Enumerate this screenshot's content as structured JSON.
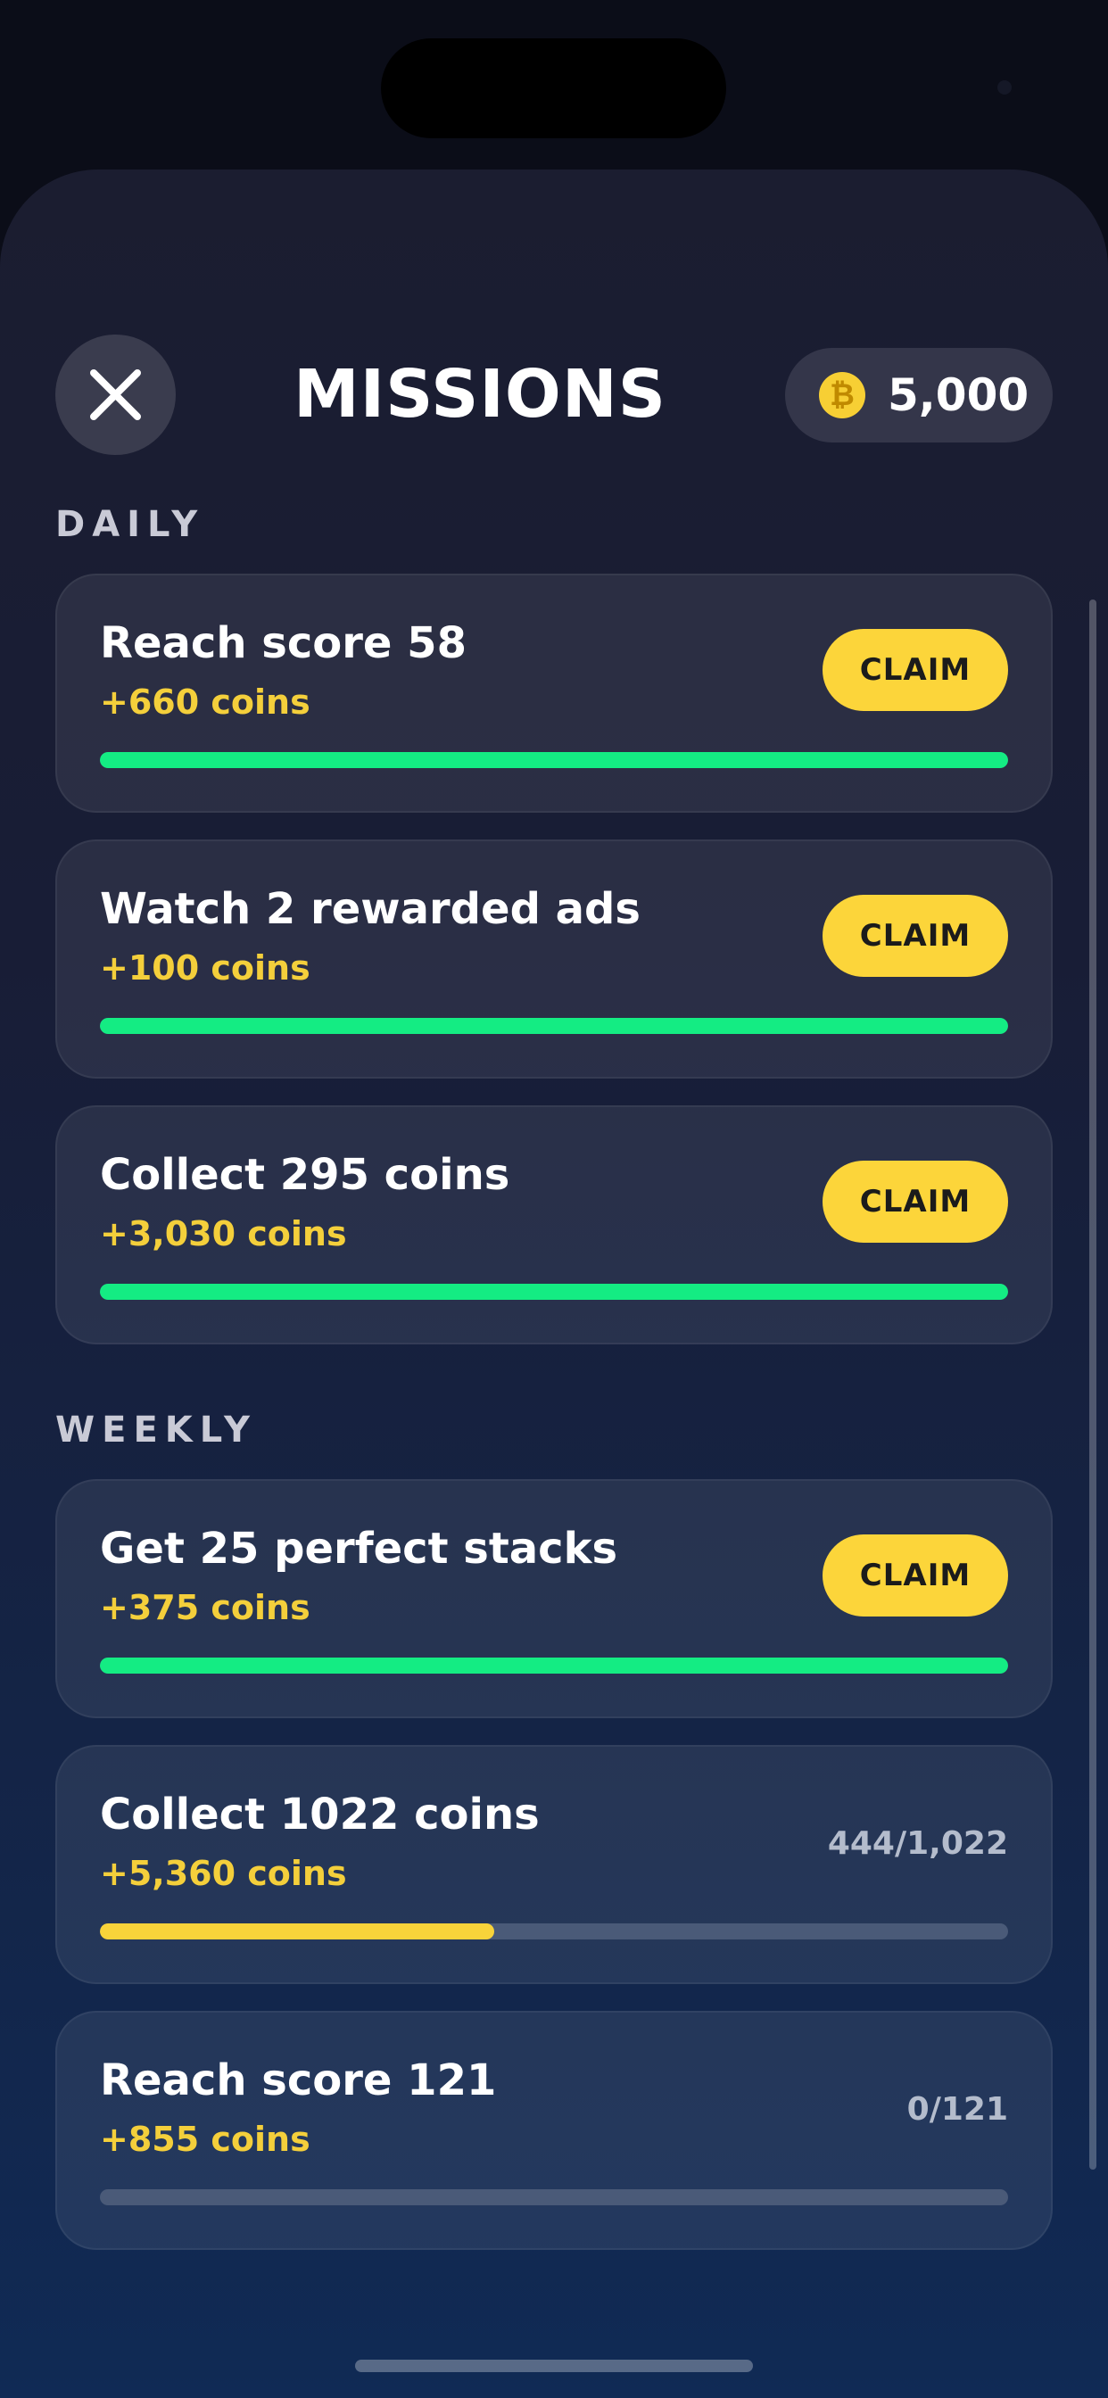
{
  "header": {
    "title": "MISSIONS",
    "close_icon": "close-icon",
    "wallet": {
      "icon": "coin-icon",
      "symbol": "₿",
      "amount": "5,000"
    }
  },
  "colors": {
    "reward": "#f4cf3b",
    "claim_button": "#fcd53a",
    "progress_complete": "#14ec83",
    "progress_partial": "#f8d33a",
    "progress_track": "#4a5a78"
  },
  "sections": {
    "daily": {
      "label": "DAILY",
      "missions": [
        {
          "title": "Reach score 58",
          "reward": "+660 coins",
          "action": "CLAIM",
          "progress": 1.0,
          "complete": true
        },
        {
          "title": "Watch 2 rewarded ads",
          "reward": "+100 coins",
          "action": "CLAIM",
          "progress": 1.0,
          "complete": true
        },
        {
          "title": "Collect 295 coins",
          "reward": "+3,030 coins",
          "action": "CLAIM",
          "progress": 1.0,
          "complete": true
        }
      ]
    },
    "weekly": {
      "label": "WEEKLY",
      "missions": [
        {
          "title": "Get 25 perfect stacks",
          "reward": "+375 coins",
          "action": "CLAIM",
          "progress": 1.0,
          "complete": true
        },
        {
          "title": "Collect 1022 coins",
          "reward": "+5,360 coins",
          "progress_text": "444/1,022",
          "progress": 0.434,
          "complete": false
        },
        {
          "title": "Reach score 121",
          "reward": "+855 coins",
          "progress_text": "0/121",
          "progress": 0.0,
          "complete": false
        }
      ]
    }
  }
}
